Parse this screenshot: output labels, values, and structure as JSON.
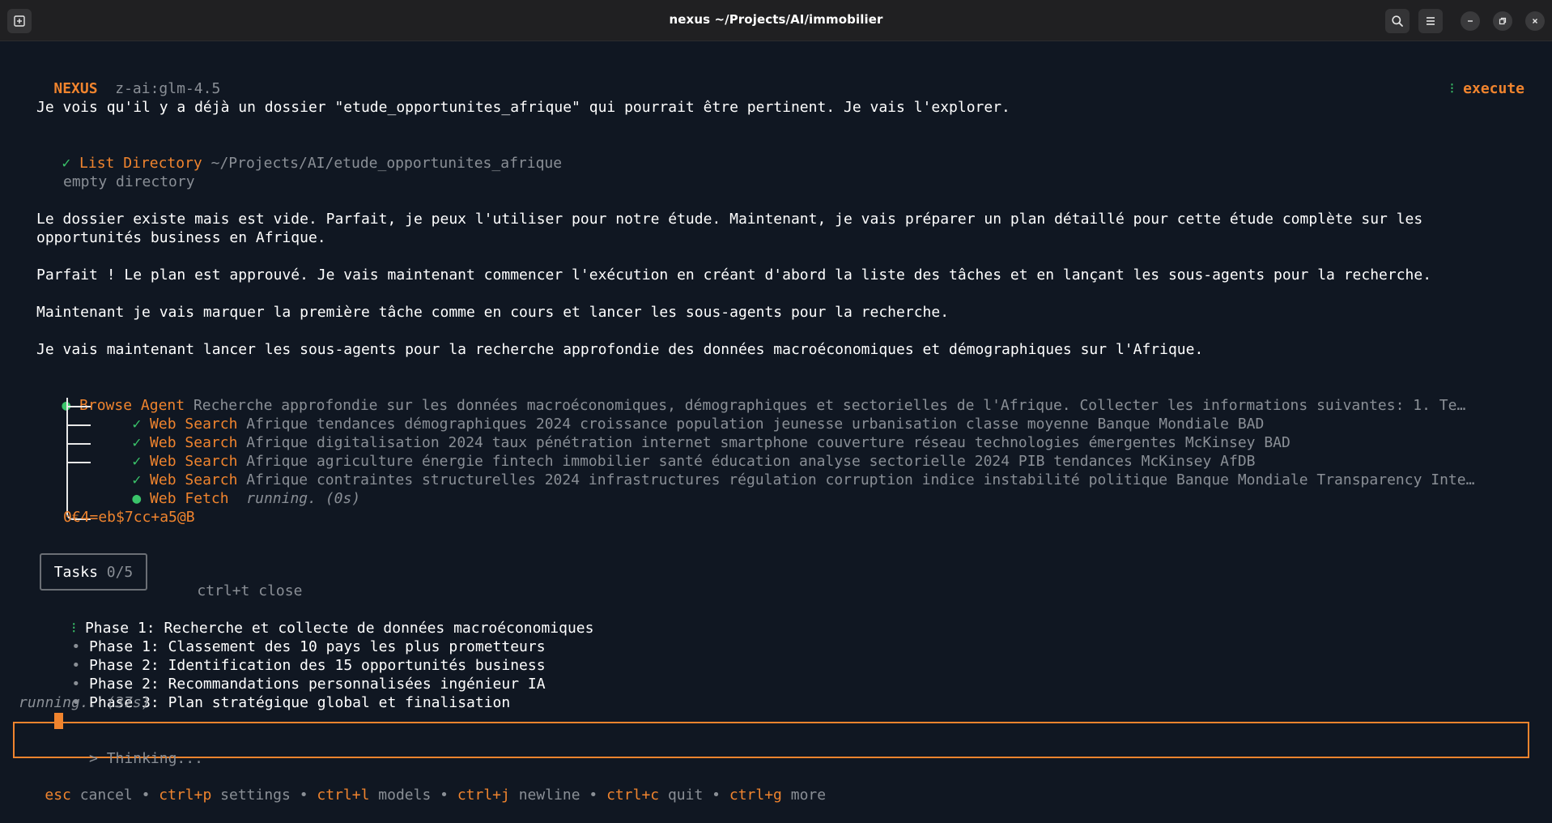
{
  "window": {
    "title": "nexus ~/Projects/AI/immobilier"
  },
  "header": {
    "app_name": "NEXUS",
    "model": "z-ai:glm-4.5",
    "mode_icon": "⁝",
    "mode": "execute"
  },
  "messages": {
    "m1": "Je vois qu'il y a déjà un dossier \"etude_opportunites_afrique\" qui pourrait être pertinent. Je vais l'explorer.",
    "tool_list_dir": {
      "check": "✓",
      "name": "List Directory",
      "arg": "~/Projects/AI/etude_opportunites_afrique",
      "result": "empty directory"
    },
    "m2_line1": "Le dossier existe mais est vide. Parfait, je peux l'utiliser pour notre étude. Maintenant, je vais préparer un plan détaillé pour cette étude complète sur les",
    "m2_line2": "opportunités business en Afrique.",
    "m3": "Parfait ! Le plan est approuvé. Je vais maintenant commencer l'exécution en créant d'abord la liste des tâches et en lançant les sous-agents pour la recherche.",
    "m4": "Maintenant je vais marquer la première tâche comme en cours et lancer les sous-agents pour la recherche.",
    "m5": "Je vais maintenant lancer les sous-agents pour la recherche approfondie des données macroéconomiques et démographiques sur l'Afrique."
  },
  "browse_agent": {
    "dot": "●",
    "name": "Browse Agent",
    "desc": "Recherche approfondie sur les données macroéconomiques, démographiques et sectorielles de l'Afrique. Collecter les informations suivantes: 1. Te…",
    "subtasks": [
      {
        "check": "✓",
        "name": "Web Search",
        "arg": "Afrique tendances démographiques 2024 croissance population jeunesse urbanisation classe moyenne Banque Mondiale BAD"
      },
      {
        "check": "✓",
        "name": "Web Search",
        "arg": "Afrique digitalisation 2024 taux pénétration internet smartphone couverture réseau technologies émergentes McKinsey BAD"
      },
      {
        "check": "✓",
        "name": "Web Search",
        "arg": "Afrique agriculture énergie fintech immobilier santé éducation analyse sectorielle 2024 PIB tendances McKinsey AfDB"
      },
      {
        "check": "✓",
        "name": "Web Search",
        "arg": "Afrique contraintes structurelles 2024 infrastructures régulation corruption indice instabilité politique Banque Mondiale Transparency Inte…"
      },
      {
        "check": "●",
        "name": "Web Fetch",
        "arg": "running. (0s)"
      }
    ],
    "garbled": "0€4=eb$7cc+a5@B"
  },
  "tasks": {
    "label": "Tasks",
    "count": "0/5",
    "close_hint_key": "ctrl+t",
    "close_hint_text": "close",
    "items": [
      {
        "bullet": "⁝",
        "text": "Phase 1: Recherche et collecte de données macroéconomiques"
      },
      {
        "bullet": "•",
        "text": "Phase 1: Classement des 10 pays les plus prometteurs"
      },
      {
        "bullet": "•",
        "text": "Phase 2: Identification des 15 opportunités business"
      },
      {
        "bullet": "•",
        "text": "Phase 2: Recommandations personnalisées ingénieur IA"
      },
      {
        "bullet": "•",
        "text": "Phase 3: Plan stratégique global et finalisation"
      }
    ],
    "status": "running.. (37s)"
  },
  "input": {
    "prompt": ">",
    "placeholder": "Thinking..."
  },
  "footer": {
    "sep": "•",
    "shortcuts": [
      {
        "key": "esc",
        "label": "cancel"
      },
      {
        "key": "ctrl+p",
        "label": "settings"
      },
      {
        "key": "ctrl+l",
        "label": "models"
      },
      {
        "key": "ctrl+j",
        "label": "newline"
      },
      {
        "key": "ctrl+c",
        "label": "quit"
      },
      {
        "key": "ctrl+g",
        "label": "more"
      }
    ]
  },
  "colors": {
    "accent": "#f0842e",
    "success": "#3ac46a",
    "background": "#101722",
    "titlebar": "#202022"
  }
}
